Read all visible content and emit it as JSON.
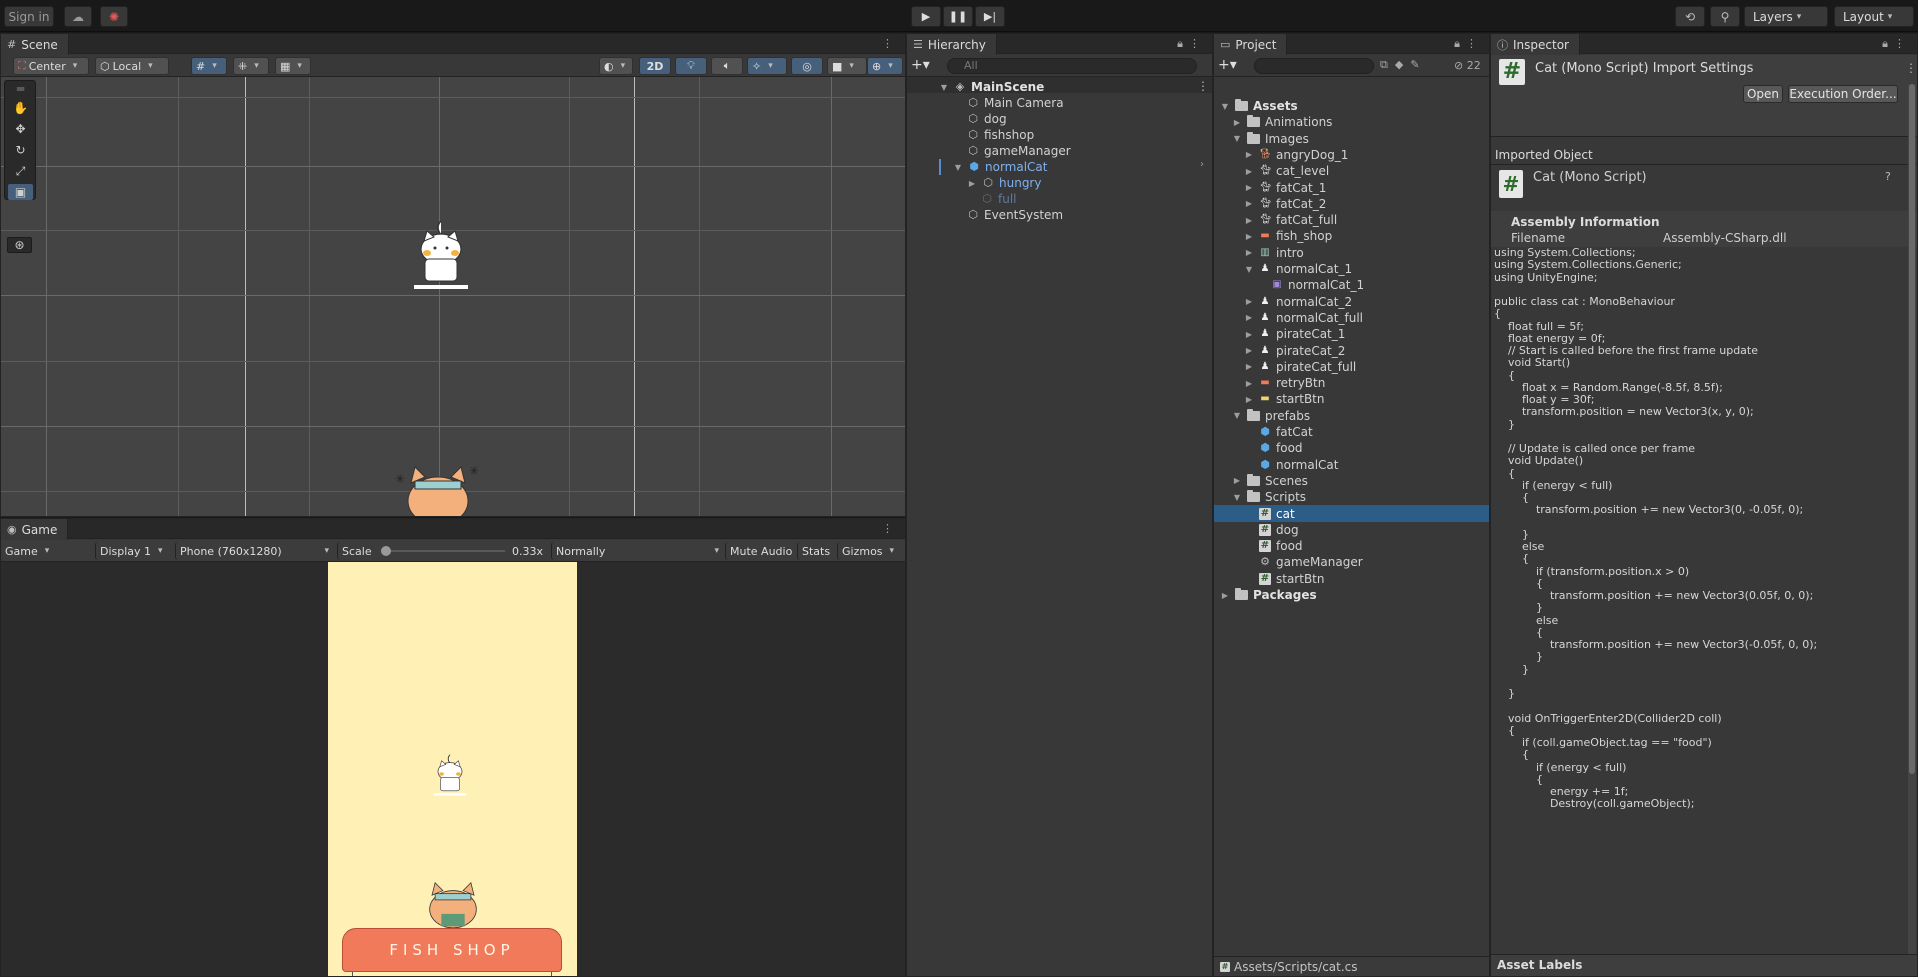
{
  "topbar": {
    "sign_in": "Sign in",
    "layers": "Layers",
    "layout": "Layout"
  },
  "scene": {
    "tab": "Scene",
    "pivot": "Center",
    "space": "Local",
    "mode_2d": "2D"
  },
  "game": {
    "tab": "Game",
    "view": "Game",
    "display": "Display 1",
    "resolution": "Phone (760x1280)",
    "scale_label": "Scale",
    "scale_value": "0.33x",
    "play_focus": "Normally",
    "mute": "Mute Audio",
    "stats": "Stats",
    "gizmos": "Gizmos",
    "shop_sign": "FISH  SHOP"
  },
  "hierarchy": {
    "tab": "Hierarchy",
    "search_placeholder": "All",
    "items": [
      {
        "label": "MainScene"
      },
      {
        "label": "Main Camera"
      },
      {
        "label": "dog"
      },
      {
        "label": "fishshop"
      },
      {
        "label": "gameManager"
      },
      {
        "label": "normalCat"
      },
      {
        "label": "hungry"
      },
      {
        "label": "full"
      },
      {
        "label": "EventSystem"
      }
    ]
  },
  "project": {
    "tab": "Project",
    "hidden_count": "22",
    "items": [
      {
        "label": "Assets"
      },
      {
        "label": "Animations"
      },
      {
        "label": "Images"
      },
      {
        "label": "angryDog_1"
      },
      {
        "label": "cat_level"
      },
      {
        "label": "fatCat_1"
      },
      {
        "label": "fatCat_2"
      },
      {
        "label": "fatCat_full"
      },
      {
        "label": "fish_shop"
      },
      {
        "label": "intro"
      },
      {
        "label": "normalCat_1"
      },
      {
        "label": "normalCat_1"
      },
      {
        "label": "normalCat_2"
      },
      {
        "label": "normalCat_full"
      },
      {
        "label": "pirateCat_1"
      },
      {
        "label": "pirateCat_2"
      },
      {
        "label": "pirateCat_full"
      },
      {
        "label": "retryBtn"
      },
      {
        "label": "startBtn"
      },
      {
        "label": "prefabs"
      },
      {
        "label": "fatCat"
      },
      {
        "label": "food"
      },
      {
        "label": "normalCat"
      },
      {
        "label": "Scenes"
      },
      {
        "label": "Scripts"
      },
      {
        "label": "cat"
      },
      {
        "label": "dog"
      },
      {
        "label": "food"
      },
      {
        "label": "gameManager"
      },
      {
        "label": "startBtn"
      },
      {
        "label": "Packages"
      }
    ],
    "footer_path": "Assets/Scripts/cat.cs"
  },
  "inspector": {
    "tab": "Inspector",
    "title": "Cat (Mono Script) Import Settings",
    "open": "Open",
    "execution_order": "Execution Order...",
    "imported_object": "Imported Object",
    "object_name": "Cat (Mono Script)",
    "assembly_header": "Assembly Information",
    "filename_label": "Filename",
    "filename_value": "Assembly-CSharp.dll",
    "code": "using System.Collections;\nusing System.Collections.Generic;\nusing UnityEngine;\n\npublic class cat : MonoBehaviour\n{\n    float full = 5f;\n    float energy = 0f;\n    // Start is called before the first frame update\n    void Start()\n    {\n        float x = Random.Range(-8.5f, 8.5f);\n        float y = 30f;\n        transform.position = new Vector3(x, y, 0);\n    }\n\n    // Update is called once per frame\n    void Update()\n    {\n        if (energy < full)\n        {\n            transform.position += new Vector3(0, -0.05f, 0);\n\n        }\n        else\n        {\n            if (transform.position.x > 0)\n            {\n                transform.position += new Vector3(0.05f, 0, 0);\n            }\n            else\n            {\n                transform.position += new Vector3(-0.05f, 0, 0);\n            }\n        }\n\n    }\n\n    void OnTriggerEnter2D(Collider2D coll)\n    {\n        if (coll.gameObject.tag == \"food\")\n        {\n            if (energy < full)\n            {\n                energy += 1f;\n                Destroy(coll.gameObject);",
    "asset_labels": "Asset Labels"
  }
}
